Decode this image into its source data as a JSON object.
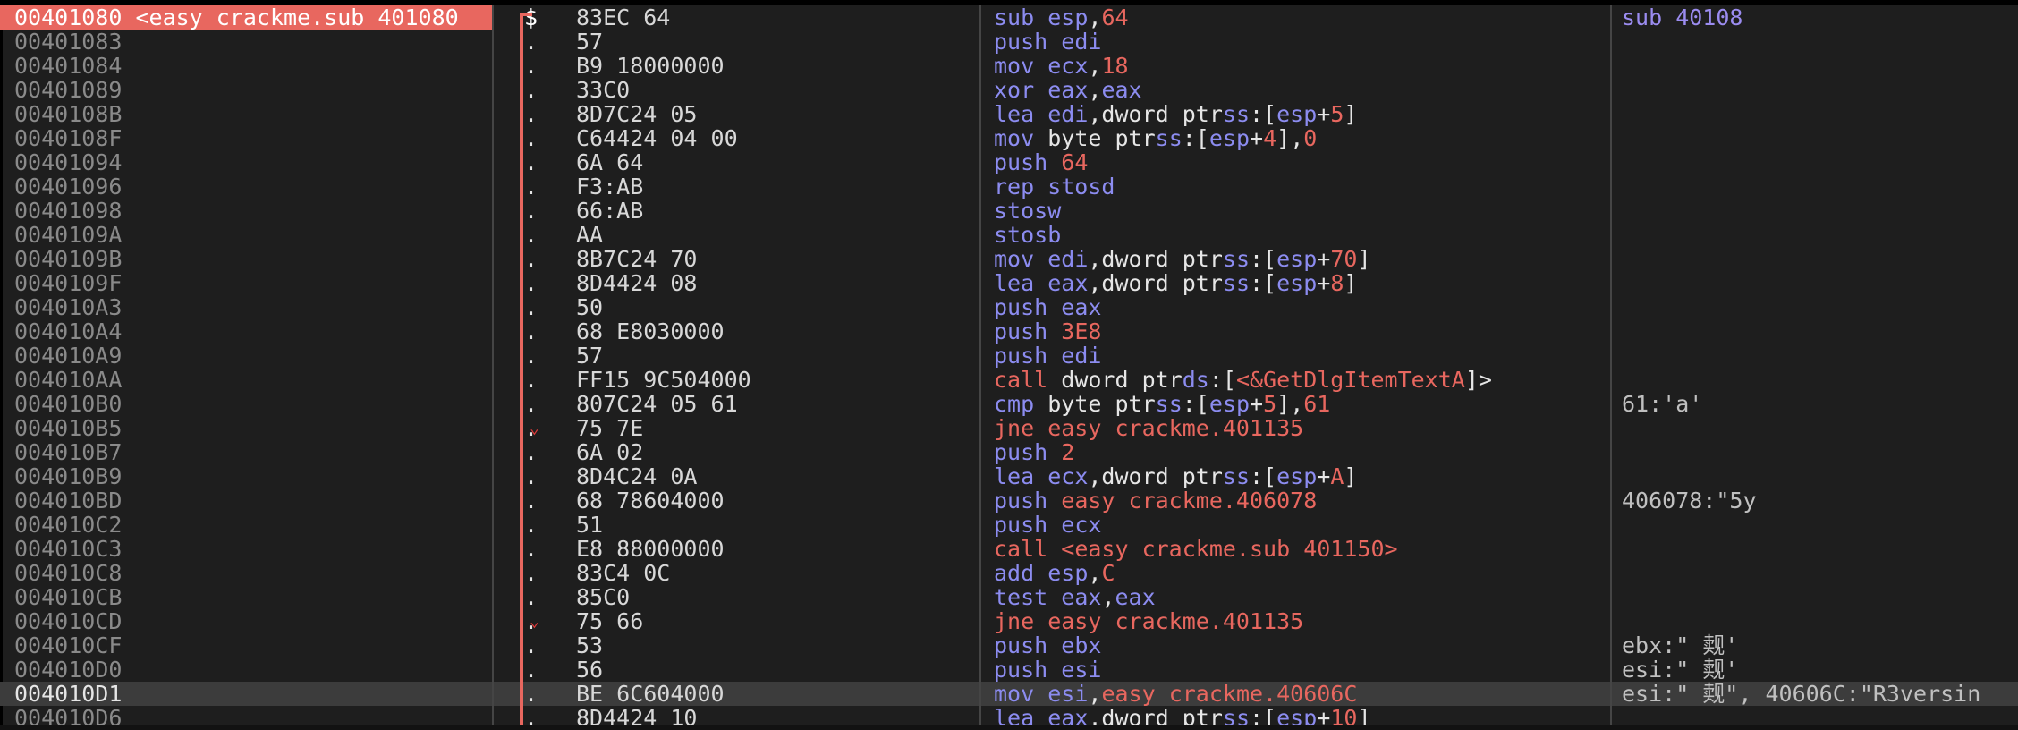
{
  "colors": {
    "eip_highlight": "#e8675f",
    "mnemonic": "#8c8cf0",
    "call_jump": "#e8675f",
    "background": "#1e1e1e"
  },
  "rows": [
    {
      "addr": "00401080 <easy_crackme.sub_401080",
      "mark": "$",
      "bytes": "83EC 64",
      "comment": "sub_40108",
      "tokens": [
        {
          "t": "sub ",
          "c": "mn"
        },
        {
          "t": "esp",
          "c": "reg"
        },
        {
          "t": ",",
          "c": "txt"
        },
        {
          "t": "64",
          "c": "num"
        }
      ]
    },
    {
      "addr": "00401083",
      "mark": ".",
      "bytes": "57",
      "comment": "",
      "tokens": [
        {
          "t": "push ",
          "c": "mn"
        },
        {
          "t": "edi",
          "c": "reg"
        }
      ]
    },
    {
      "addr": "00401084",
      "mark": ".",
      "bytes": "B9 18000000",
      "comment": "",
      "tokens": [
        {
          "t": "mov ",
          "c": "mn"
        },
        {
          "t": "ecx",
          "c": "reg"
        },
        {
          "t": ",",
          "c": "txt"
        },
        {
          "t": "18",
          "c": "num"
        }
      ]
    },
    {
      "addr": "00401089",
      "mark": ".",
      "bytes": "33C0",
      "comment": "",
      "tokens": [
        {
          "t": "xor ",
          "c": "mn"
        },
        {
          "t": "eax",
          "c": "reg"
        },
        {
          "t": ",",
          "c": "txt"
        },
        {
          "t": "eax",
          "c": "reg"
        }
      ]
    },
    {
      "addr": "0040108B",
      "mark": ".",
      "bytes": "8D7C24 05",
      "comment": "",
      "tokens": [
        {
          "t": "lea ",
          "c": "mn"
        },
        {
          "t": "edi",
          "c": "reg"
        },
        {
          "t": ",dword ptr",
          "c": "txt"
        },
        {
          "t": "ss",
          "c": "seg"
        },
        {
          "t": ":[",
          "c": "txt"
        },
        {
          "t": "esp",
          "c": "reg"
        },
        {
          "t": "+",
          "c": "txt"
        },
        {
          "t": "5",
          "c": "num"
        },
        {
          "t": "]",
          "c": "txt"
        }
      ]
    },
    {
      "addr": "0040108F",
      "mark": ".",
      "bytes": "C64424 04 00",
      "comment": "",
      "tokens": [
        {
          "t": "mov ",
          "c": "mn"
        },
        {
          "t": "byte ptr",
          "c": "txt"
        },
        {
          "t": "ss",
          "c": "seg"
        },
        {
          "t": ":[",
          "c": "txt"
        },
        {
          "t": "esp",
          "c": "reg"
        },
        {
          "t": "+",
          "c": "txt"
        },
        {
          "t": "4",
          "c": "num"
        },
        {
          "t": "],",
          "c": "txt"
        },
        {
          "t": "0",
          "c": "num"
        }
      ]
    },
    {
      "addr": "00401094",
      "mark": ".",
      "bytes": "6A 64",
      "comment": "",
      "tokens": [
        {
          "t": "push ",
          "c": "mn"
        },
        {
          "t": "64",
          "c": "num"
        }
      ]
    },
    {
      "addr": "00401096",
      "mark": ".",
      "bytes": "F3:AB",
      "comment": "",
      "tokens": [
        {
          "t": "rep stosd",
          "c": "mn"
        }
      ]
    },
    {
      "addr": "00401098",
      "mark": ".",
      "bytes": "66:AB",
      "comment": "",
      "tokens": [
        {
          "t": "stosw",
          "c": "mn"
        }
      ]
    },
    {
      "addr": "0040109A",
      "mark": ".",
      "bytes": "AA",
      "comment": "",
      "tokens": [
        {
          "t": "stosb",
          "c": "mn"
        }
      ]
    },
    {
      "addr": "0040109B",
      "mark": ".",
      "bytes": "8B7C24 70",
      "comment": "",
      "tokens": [
        {
          "t": "mov ",
          "c": "mn"
        },
        {
          "t": "edi",
          "c": "reg"
        },
        {
          "t": ",dword ptr",
          "c": "txt"
        },
        {
          "t": "ss",
          "c": "seg"
        },
        {
          "t": ":[",
          "c": "txt"
        },
        {
          "t": "esp",
          "c": "reg"
        },
        {
          "t": "+",
          "c": "txt"
        },
        {
          "t": "70",
          "c": "num"
        },
        {
          "t": "]",
          "c": "txt"
        }
      ]
    },
    {
      "addr": "0040109F",
      "mark": ".",
      "bytes": "8D4424 08",
      "comment": "",
      "tokens": [
        {
          "t": "lea ",
          "c": "mn"
        },
        {
          "t": "eax",
          "c": "reg"
        },
        {
          "t": ",dword ptr",
          "c": "txt"
        },
        {
          "t": "ss",
          "c": "seg"
        },
        {
          "t": ":[",
          "c": "txt"
        },
        {
          "t": "esp",
          "c": "reg"
        },
        {
          "t": "+",
          "c": "txt"
        },
        {
          "t": "8",
          "c": "num"
        },
        {
          "t": "]",
          "c": "txt"
        }
      ]
    },
    {
      "addr": "004010A3",
      "mark": ".",
      "bytes": "50",
      "comment": "",
      "tokens": [
        {
          "t": "push ",
          "c": "mn"
        },
        {
          "t": "eax",
          "c": "reg"
        }
      ]
    },
    {
      "addr": "004010A4",
      "mark": ".",
      "bytes": "68 E8030000",
      "comment": "",
      "tokens": [
        {
          "t": "push ",
          "c": "mn"
        },
        {
          "t": "3E8",
          "c": "num"
        }
      ]
    },
    {
      "addr": "004010A9",
      "mark": ".",
      "bytes": "57",
      "comment": "",
      "tokens": [
        {
          "t": "push ",
          "c": "mn"
        },
        {
          "t": "edi",
          "c": "reg"
        }
      ]
    },
    {
      "addr": "004010AA",
      "mark": ".",
      "bytes": "FF15 9C504000",
      "comment": "",
      "tokens": [
        {
          "t": "call ",
          "c": "call"
        },
        {
          "t": "dword ptr",
          "c": "txt"
        },
        {
          "t": "ds",
          "c": "seg"
        },
        {
          "t": ":[",
          "c": "txt"
        },
        {
          "t": "<&GetDlgItemTextA",
          "c": "sym"
        },
        {
          "t": "]>",
          "c": "txt"
        }
      ]
    },
    {
      "addr": "004010B0",
      "mark": ".",
      "bytes": "807C24 05 61",
      "comment": "61:'a'",
      "tokens": [
        {
          "t": "cmp ",
          "c": "mn"
        },
        {
          "t": "byte ptr",
          "c": "txt"
        },
        {
          "t": "ss",
          "c": "seg"
        },
        {
          "t": ":[",
          "c": "txt"
        },
        {
          "t": "esp",
          "c": "reg"
        },
        {
          "t": "+",
          "c": "txt"
        },
        {
          "t": "5",
          "c": "num"
        },
        {
          "t": "],",
          "c": "txt"
        },
        {
          "t": "61",
          "c": "num"
        }
      ]
    },
    {
      "addr": "004010B5",
      "mark": ".",
      "jump": true,
      "bytes": "75 7E",
      "comment": "",
      "tokens": [
        {
          "t": "jne easy_crackme.401135",
          "c": "jmp"
        }
      ]
    },
    {
      "addr": "004010B7",
      "mark": ".",
      "bytes": "6A 02",
      "comment": "",
      "tokens": [
        {
          "t": "push ",
          "c": "mn"
        },
        {
          "t": "2",
          "c": "num"
        }
      ]
    },
    {
      "addr": "004010B9",
      "mark": ".",
      "bytes": "8D4C24 0A",
      "comment": "",
      "tokens": [
        {
          "t": "lea ",
          "c": "mn"
        },
        {
          "t": "ecx",
          "c": "reg"
        },
        {
          "t": ",dword ptr",
          "c": "txt"
        },
        {
          "t": "ss",
          "c": "seg"
        },
        {
          "t": ":[",
          "c": "txt"
        },
        {
          "t": "esp",
          "c": "reg"
        },
        {
          "t": "+",
          "c": "txt"
        },
        {
          "t": "A",
          "c": "num"
        },
        {
          "t": "]",
          "c": "txt"
        }
      ]
    },
    {
      "addr": "004010BD",
      "mark": ".",
      "bytes": "68 78604000",
      "comment": "406078:\"5y",
      "tokens": [
        {
          "t": "push ",
          "c": "mn"
        },
        {
          "t": "easy_crackme.406078",
          "c": "sym"
        }
      ]
    },
    {
      "addr": "004010C2",
      "mark": ".",
      "bytes": "51",
      "comment": "",
      "tokens": [
        {
          "t": "push ",
          "c": "mn"
        },
        {
          "t": "ecx",
          "c": "reg"
        }
      ]
    },
    {
      "addr": "004010C3",
      "mark": ".",
      "bytes": "E8 88000000",
      "comment": "",
      "tokens": [
        {
          "t": "call ",
          "c": "call"
        },
        {
          "t": "<easy_crackme.sub_401150>",
          "c": "sym"
        }
      ]
    },
    {
      "addr": "004010C8",
      "mark": ".",
      "bytes": "83C4 0C",
      "comment": "",
      "tokens": [
        {
          "t": "add ",
          "c": "mn"
        },
        {
          "t": "esp",
          "c": "reg"
        },
        {
          "t": ",",
          "c": "txt"
        },
        {
          "t": "C",
          "c": "num"
        }
      ]
    },
    {
      "addr": "004010CB",
      "mark": ".",
      "bytes": "85C0",
      "comment": "",
      "tokens": [
        {
          "t": "test ",
          "c": "mn"
        },
        {
          "t": "eax",
          "c": "reg"
        },
        {
          "t": ",",
          "c": "txt"
        },
        {
          "t": "eax",
          "c": "reg"
        }
      ]
    },
    {
      "addr": "004010CD",
      "mark": ".",
      "jump": true,
      "bytes": "75 66",
      "comment": "",
      "tokens": [
        {
          "t": "jne easy_crackme.401135",
          "c": "jmp"
        }
      ]
    },
    {
      "addr": "004010CF",
      "mark": ".",
      "bytes": "53",
      "comment": "ebx:\" 觌'",
      "tokens": [
        {
          "t": "push ",
          "c": "mn"
        },
        {
          "t": "ebx",
          "c": "reg"
        }
      ]
    },
    {
      "addr": "004010D0",
      "mark": ".",
      "bytes": "56",
      "comment": "esi:\" 觌'",
      "tokens": [
        {
          "t": "push ",
          "c": "mn"
        },
        {
          "t": "esi",
          "c": "reg"
        }
      ]
    },
    {
      "addr": "004010D1",
      "mark": ".",
      "current": true,
      "bytes": "BE 6C604000",
      "comment": "esi:\" 觌\", 40606C:\"R3versin",
      "tokens": [
        {
          "t": "mov ",
          "c": "mn"
        },
        {
          "t": "esi",
          "c": "reg"
        },
        {
          "t": ",",
          "c": "txt"
        },
        {
          "t": "easy_crackme.40606C",
          "c": "sym"
        }
      ]
    },
    {
      "addr": "004010D6",
      "mark": ".",
      "bytes": "8D4424 10",
      "comment": "",
      "tokens": [
        {
          "t": "lea ",
          "c": "mn"
        },
        {
          "t": "eax",
          "c": "reg"
        },
        {
          "t": ",dword ptr",
          "c": "txt"
        },
        {
          "t": "ss",
          "c": "seg"
        },
        {
          "t": ":[",
          "c": "txt"
        },
        {
          "t": "esp",
          "c": "reg"
        },
        {
          "t": "+",
          "c": "txt"
        },
        {
          "t": "10",
          "c": "num"
        },
        {
          "t": "]",
          "c": "txt"
        }
      ]
    }
  ]
}
